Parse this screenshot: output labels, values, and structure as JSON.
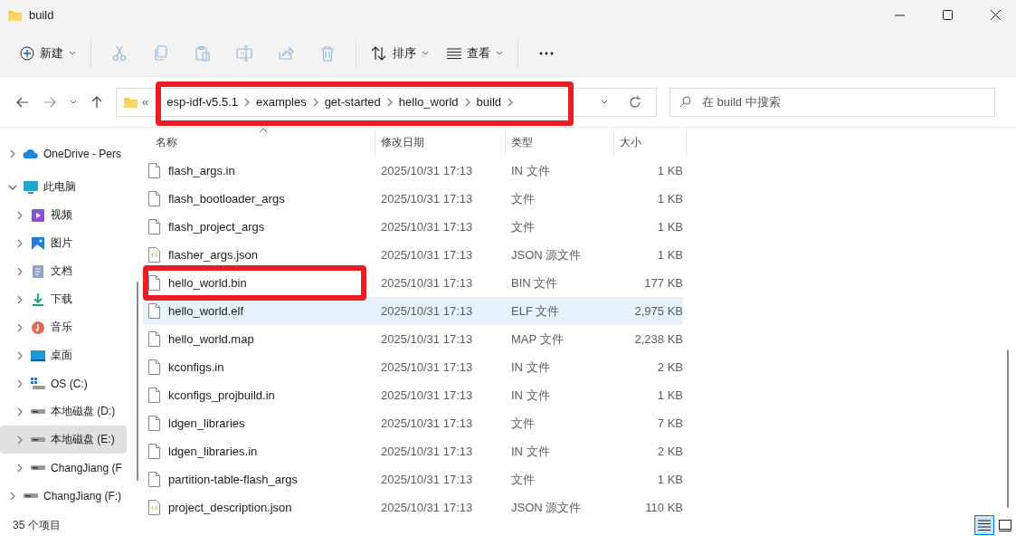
{
  "window": {
    "title": "build"
  },
  "toolbar": {
    "new_button": {
      "label": "新建"
    },
    "actions": [
      {
        "kind": "cut",
        "disabled": true
      },
      {
        "kind": "copy",
        "disabled": true
      },
      {
        "kind": "paste",
        "disabled": true
      },
      {
        "kind": "rename",
        "disabled": true
      },
      {
        "kind": "share",
        "disabled": true
      },
      {
        "kind": "delete",
        "disabled": true
      }
    ],
    "sort_button": {
      "label": "排序"
    },
    "view_button": {
      "label": "查看"
    }
  },
  "address": {
    "overflow": "«",
    "segments": [
      "esp-idf-v5.5.1",
      "examples",
      "get-started",
      "hello_world",
      "build"
    ],
    "highlighted": true
  },
  "search": {
    "placeholder": "在 build 中搜索"
  },
  "sidebar": {
    "items": [
      {
        "label": "OneDrive - Pers",
        "kind": "cloud",
        "expanded": false,
        "selected": false
      },
      {
        "label": "此电脑",
        "kind": "computer",
        "expanded": true,
        "selected": false,
        "children": [
          {
            "label": "视频",
            "kind": "video",
            "expanded": false,
            "selected": false
          },
          {
            "label": "图片",
            "kind": "pictures",
            "expanded": false,
            "selected": false
          },
          {
            "label": "文档",
            "kind": "documents",
            "expanded": false,
            "selected": false
          },
          {
            "label": "下载",
            "kind": "downloads",
            "expanded": false,
            "selected": false
          },
          {
            "label": "音乐",
            "kind": "music",
            "expanded": false,
            "selected": false
          },
          {
            "label": "桌面",
            "kind": "desktop",
            "expanded": false,
            "selected": false
          },
          {
            "label": "OS (C:)",
            "kind": "system-drive",
            "expanded": false,
            "selected": false
          },
          {
            "label": "本地磁盘 (D:)",
            "kind": "drive",
            "expanded": false,
            "selected": false
          },
          {
            "label": "本地磁盘 (E:)",
            "kind": "drive",
            "expanded": false,
            "selected": true
          },
          {
            "label": "ChangJiang (F",
            "kind": "drive",
            "expanded": false,
            "selected": false
          }
        ]
      },
      {
        "label": "ChangJiang (F:)",
        "kind": "drive",
        "expanded": false,
        "selected": false
      }
    ]
  },
  "table": {
    "columns": [
      {
        "label": "名称",
        "sorted": true
      },
      {
        "label": "修改日期",
        "sorted": false
      },
      {
        "label": "类型",
        "sorted": false
      },
      {
        "label": "大小",
        "sorted": false
      }
    ],
    "rows": [
      {
        "name": "flash_args.in",
        "modified": "2025/10/31 17:13",
        "type": "IN 文件",
        "size": "1 KB",
        "kind": "file",
        "selected": false,
        "highlighted": false
      },
      {
        "name": "flash_bootloader_args",
        "modified": "2025/10/31 17:13",
        "type": "文件",
        "size": "1 KB",
        "kind": "file",
        "selected": false,
        "highlighted": false
      },
      {
        "name": "flash_project_args",
        "modified": "2025/10/31 17:13",
        "type": "文件",
        "size": "1 KB",
        "kind": "file",
        "selected": false,
        "highlighted": false
      },
      {
        "name": "flasher_args.json",
        "modified": "2025/10/31 17:13",
        "type": "JSON 源文件",
        "size": "1 KB",
        "kind": "json",
        "selected": false,
        "highlighted": false
      },
      {
        "name": "hello_world.bin",
        "modified": "2025/10/31 17:13",
        "type": "BIN 文件",
        "size": "177 KB",
        "kind": "file",
        "selected": false,
        "highlighted": true
      },
      {
        "name": "hello_world.elf",
        "modified": "2025/10/31 17:13",
        "type": "ELF 文件",
        "size": "2,975 KB",
        "kind": "file",
        "selected": true,
        "highlighted": false
      },
      {
        "name": "hello_world.map",
        "modified": "2025/10/31 17:13",
        "type": "MAP 文件",
        "size": "2,238 KB",
        "kind": "file",
        "selected": false,
        "highlighted": false
      },
      {
        "name": "kconfigs.in",
        "modified": "2025/10/31 17:13",
        "type": "IN 文件",
        "size": "2 KB",
        "kind": "file",
        "selected": false,
        "highlighted": false
      },
      {
        "name": "kconfigs_projbuild.in",
        "modified": "2025/10/31 17:13",
        "type": "IN 文件",
        "size": "1 KB",
        "kind": "file",
        "selected": false,
        "highlighted": false
      },
      {
        "name": "ldgen_libraries",
        "modified": "2025/10/31 17:13",
        "type": "文件",
        "size": "7 KB",
        "kind": "file",
        "selected": false,
        "highlighted": false
      },
      {
        "name": "ldgen_libraries.in",
        "modified": "2025/10/31 17:13",
        "type": "IN 文件",
        "size": "2 KB",
        "kind": "file",
        "selected": false,
        "highlighted": false
      },
      {
        "name": "partition-table-flash_args",
        "modified": "2025/10/31 17:13",
        "type": "文件",
        "size": "1 KB",
        "kind": "file",
        "selected": false,
        "highlighted": false
      },
      {
        "name": "project_description.json",
        "modified": "2025/10/31 17:13",
        "type": "JSON 源文件",
        "size": "110 KB",
        "kind": "json",
        "selected": false,
        "highlighted": false
      }
    ]
  },
  "status_bar": {
    "item_count": "35 个项目",
    "views": [
      {
        "kind": "details",
        "selected": true
      },
      {
        "kind": "tiles",
        "selected": false
      }
    ]
  }
}
